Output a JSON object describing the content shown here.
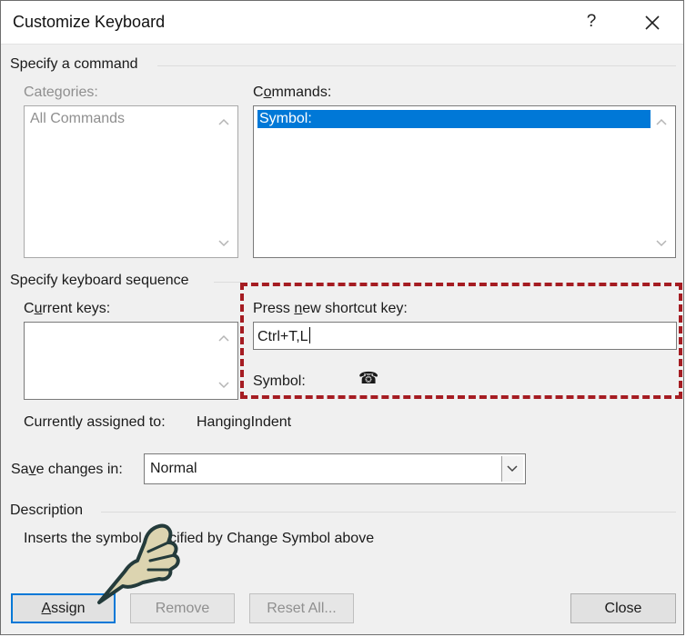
{
  "window": {
    "title": "Customize Keyboard",
    "help_glyph": "?"
  },
  "specify_command": {
    "section_title": "Specify a command",
    "categories_label": "Categories:",
    "categories_items": [
      "All Commands"
    ],
    "commands_label_pre": "C",
    "commands_label_ul": "o",
    "commands_label_post": "mmands:",
    "commands_items": [
      "Symbol:"
    ]
  },
  "keyboard_sequence": {
    "section_title": "Specify keyboard sequence",
    "current_keys_label_pre": "C",
    "current_keys_label_ul": "u",
    "current_keys_label_post": "rrent keys:",
    "press_new_label_pre": "Press ",
    "press_new_label_ul": "n",
    "press_new_label_post": "ew shortcut key:",
    "shortcut_value": "Ctrl+T,L",
    "symbol_label": "Symbol:",
    "symbol_glyph": "☎",
    "currently_assigned_label": "Currently assigned to:",
    "currently_assigned_value": "HangingIndent"
  },
  "save_changes": {
    "label_pre": "Sa",
    "label_ul": "v",
    "label_post": "e changes in:",
    "value": "Normal"
  },
  "description": {
    "section_title": "Description",
    "text": "Inserts the symbol specified by Change Symbol above"
  },
  "buttons": {
    "assign": "Assign",
    "assign_ul": "A",
    "assign_rest": "ssign",
    "remove": "Remove",
    "reset_all": "Reset All...",
    "close": "Close"
  },
  "colors": {
    "selection": "#0078d7",
    "highlight_dash": "#a51c22"
  }
}
